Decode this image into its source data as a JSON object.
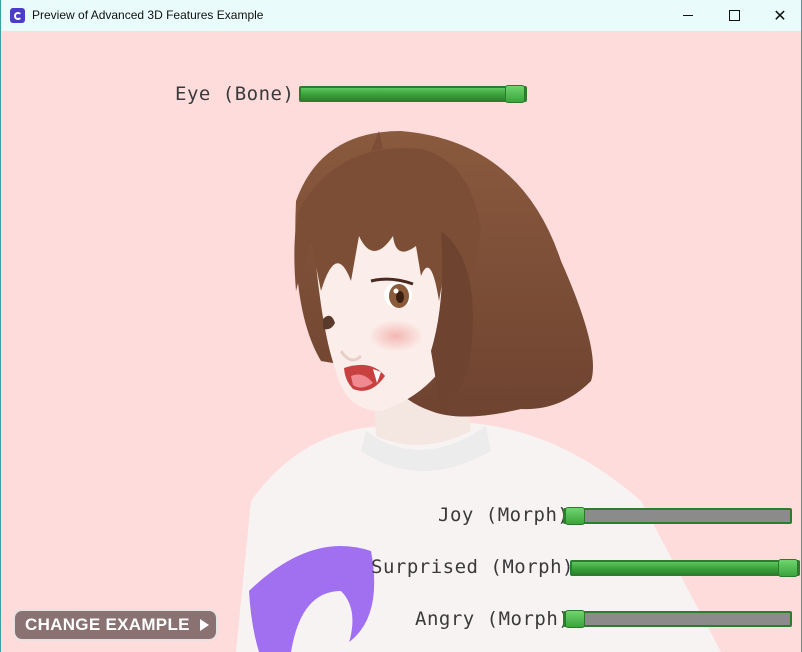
{
  "window": {
    "title": "Preview of Advanced 3D Features Example"
  },
  "controls": {
    "eye": {
      "label": "Eye (Bone)",
      "value": 1.0
    },
    "joy": {
      "label": "Joy (Morph)",
      "value": 0.0
    },
    "surprised": {
      "label": "Surprised (Morph)",
      "value": 1.0
    },
    "angry": {
      "label": "Angry (Morph)",
      "value": 0.0
    }
  },
  "button": {
    "label": "CHANGE EXAMPLE"
  },
  "colors": {
    "accent": "#3aa03a",
    "background": "#fedcdc",
    "track": "#8b8b8b"
  }
}
